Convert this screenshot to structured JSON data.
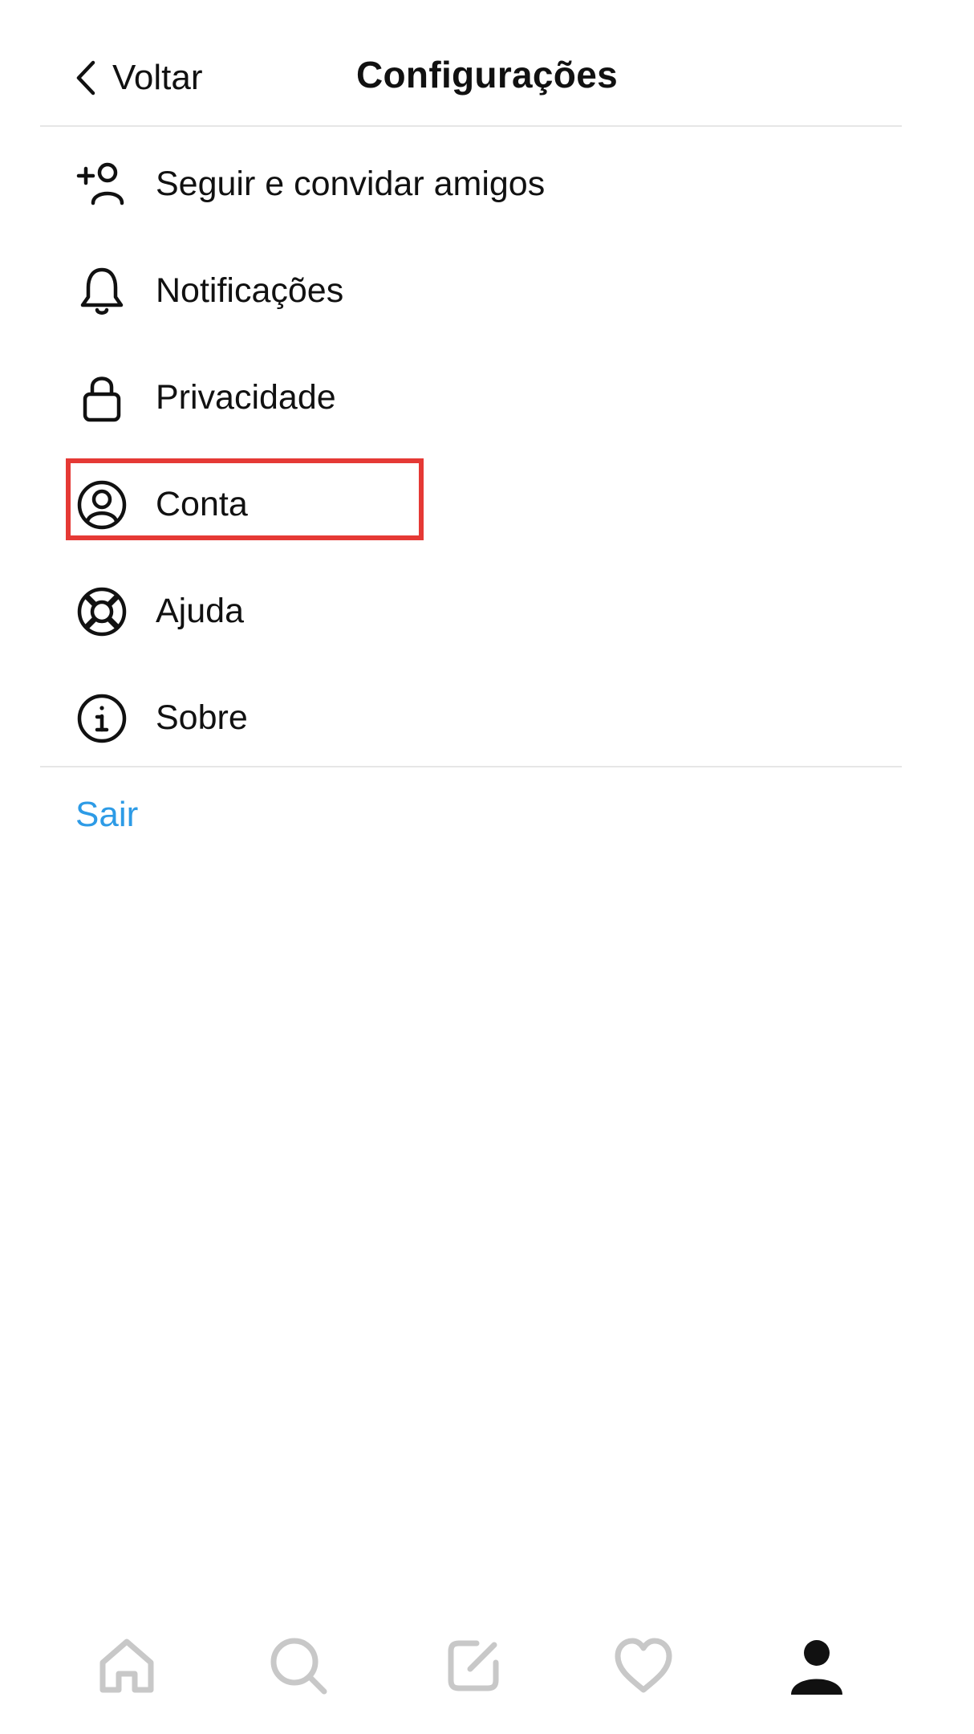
{
  "header": {
    "back_label": "Voltar",
    "title": "Configurações"
  },
  "menu": {
    "items": [
      {
        "id": "follow-invite",
        "icon": "add-person-icon",
        "label": "Seguir e convidar amigos"
      },
      {
        "id": "notifications",
        "icon": "bell-icon",
        "label": "Notificações"
      },
      {
        "id": "privacy",
        "icon": "lock-icon",
        "label": "Privacidade"
      },
      {
        "id": "account",
        "icon": "user-circle-icon",
        "label": "Conta",
        "highlighted": true
      },
      {
        "id": "help",
        "icon": "lifebuoy-icon",
        "label": "Ajuda"
      },
      {
        "id": "about",
        "icon": "info-icon",
        "label": "Sobre"
      }
    ]
  },
  "logout": {
    "label": "Sair"
  },
  "bottom_nav": {
    "items": [
      {
        "id": "home",
        "icon": "home-icon"
      },
      {
        "id": "search",
        "icon": "search-icon"
      },
      {
        "id": "compose",
        "icon": "compose-icon"
      },
      {
        "id": "activity",
        "icon": "heart-icon"
      },
      {
        "id": "profile",
        "icon": "profile-icon",
        "active": true
      }
    ]
  },
  "colors": {
    "text": "#111111",
    "link": "#2d9be6",
    "highlight": "#e53935",
    "divider": "#e6e6e6",
    "nav_inactive": "#c8c8c8"
  }
}
